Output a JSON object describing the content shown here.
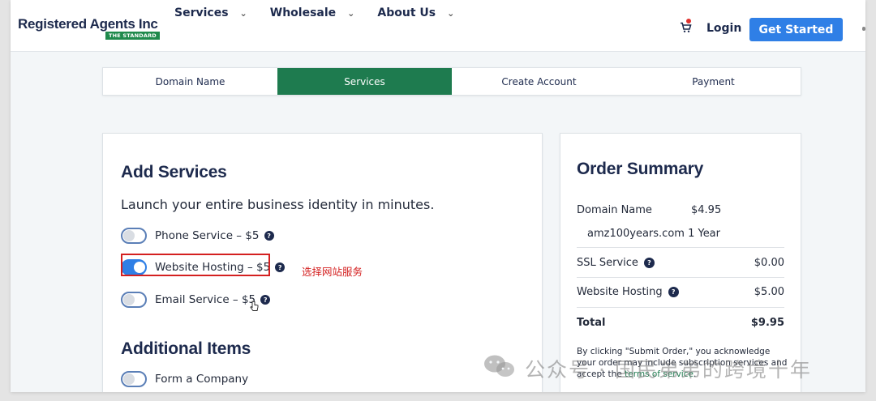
{
  "header": {
    "logo_text": "Registered Agents Inc",
    "logo_badge": "THE STANDARD",
    "nav": [
      {
        "label": "Services"
      },
      {
        "label": "Wholesale"
      },
      {
        "label": "About Us"
      }
    ],
    "login": "Login",
    "cta": "Get Started"
  },
  "steps": [
    {
      "label": "Domain Name",
      "active": false
    },
    {
      "label": "Services",
      "active": true
    },
    {
      "label": "Create Account",
      "active": false
    },
    {
      "label": "Payment",
      "active": false
    }
  ],
  "add_services": {
    "title": "Add Services",
    "subtitle": "Launch your entire business identity in minutes.",
    "items": [
      {
        "label": "Phone Service  – $5",
        "on": false
      },
      {
        "label": "Website Hosting  – $5",
        "on": true
      },
      {
        "label": "Email Service  – $5",
        "on": false
      }
    ],
    "annotation": "选择网站服务"
  },
  "additional_items": {
    "title": "Additional Items",
    "items": [
      {
        "label": "Form a Company",
        "on": false
      }
    ]
  },
  "order_summary": {
    "title": "Order Summary",
    "domain_label": "Domain Name",
    "domain_price": "$4.95",
    "domain_value": "amz100years.com 1 Year",
    "rows": [
      {
        "label": "SSL Service",
        "price": "$0.00"
      },
      {
        "label": "Website Hosting",
        "price": "$5.00"
      }
    ],
    "total_label": "Total",
    "total_price": "$9.95",
    "disclaimer": "By clicking \"Submit Order,\" you acknowledge your order may include subscription services and accept the ",
    "terms_link": "terms of service",
    "disclaimer_end": "."
  },
  "watermark": "公众号 · 国民弟弟的跨境十年",
  "colors": {
    "accent_green": "#1e7b4f",
    "primary_blue": "#2f7fe6",
    "navy_text": "#1d2a4d",
    "annotation_red": "#d42020"
  },
  "icons": {
    "cart": "cart-icon",
    "help": "question-circle-icon",
    "chevron": "chevron-down-icon"
  }
}
